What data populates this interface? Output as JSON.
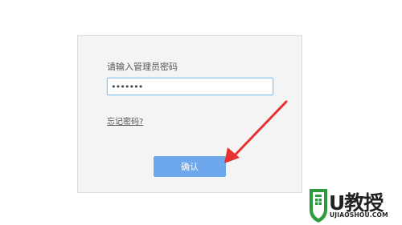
{
  "login": {
    "prompt": "请输入管理员密码",
    "password_value": "•••••••",
    "forgot_link": "忘记密码?",
    "confirm_button": "确认"
  },
  "watermark": {
    "logo_text": "U教授",
    "logo_subtext": "UJIAOSHOU.COM"
  },
  "colors": {
    "accent": "#6ea8ec",
    "arrow": "#e8312f",
    "logo_green": "#2e9a3e"
  },
  "icons": [
    "arrow-annotation",
    "shield-logo-icon"
  ]
}
